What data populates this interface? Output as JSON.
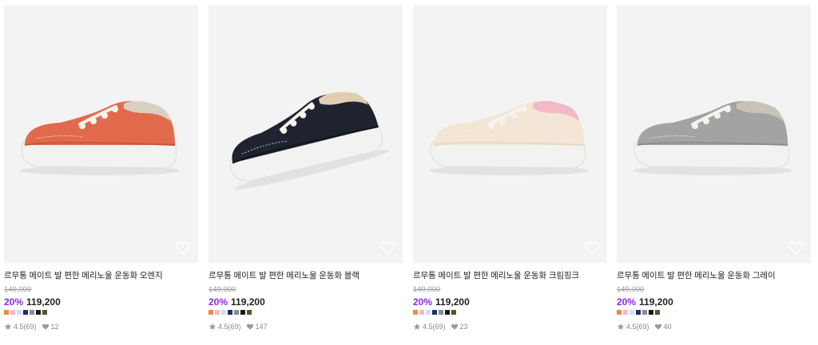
{
  "products": [
    {
      "title": "르무통 메이트 발 편한 메리노울 운동화 오렌지",
      "original_price": "149,000",
      "discount": "20%",
      "price": "119,200",
      "rating": "4.5(69)",
      "likes": "12",
      "upper_color": "#e26a4c",
      "upper_dark": "#c9553a",
      "collar_color": "#d9cfc3",
      "swatches": [
        "#f08a3c",
        "#f4b6c8",
        "#cfe0f4",
        "#1f2f6b",
        "#8c8c8c",
        "#1a1a1a",
        "#4a5a30"
      ]
    },
    {
      "title": "르무통 메이트 발 편한 메리노울 운동화 블랙",
      "original_price": "149,000",
      "discount": "20%",
      "price": "119,200",
      "rating": "4.5(69)",
      "likes": "147",
      "upper_color": "#1f2330",
      "upper_dark": "#12151e",
      "collar_color": "#e3cdb2",
      "swatches": [
        "#f08a3c",
        "#f4b6c8",
        "#cfe0f4",
        "#1f2f6b",
        "#8c8c8c",
        "#1a1a1a",
        "#4a5a30"
      ]
    },
    {
      "title": "르무통 메이트 발 편한 메리노울 운동화 크림핑크",
      "original_price": "149,000",
      "discount": "20%",
      "price": "119,200",
      "rating": "4.5(69)",
      "likes": "23",
      "upper_color": "#f3e6d6",
      "upper_dark": "#e8d7c3",
      "collar_color": "#f2b9c6",
      "swatches": [
        "#f08a3c",
        "#f4b6c8",
        "#cfe0f4",
        "#1f2f6b",
        "#8c8c8c",
        "#1a1a1a",
        "#4a5a30"
      ]
    },
    {
      "title": "르무통 메이트 발 편한 메리노울 운동화 그레이",
      "original_price": "149,000",
      "discount": "20%",
      "price": "119,200",
      "rating": "4.5(69)",
      "likes": "40",
      "upper_color": "#a3a3a3",
      "upper_dark": "#8d8d8d",
      "collar_color": "#c9c2b6",
      "swatches": [
        "#f08a3c",
        "#f4b6c8",
        "#cfe0f4",
        "#1f2f6b",
        "#8c8c8c",
        "#1a1a1a",
        "#4a5a30"
      ]
    }
  ]
}
